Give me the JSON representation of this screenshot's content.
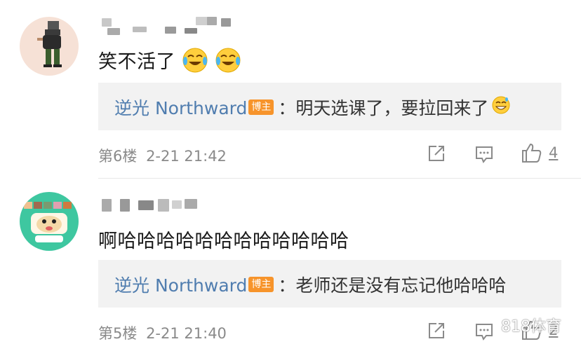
{
  "comments": [
    {
      "text": "笑不活了",
      "reply": {
        "author": "逆光 Northward",
        "badge": "博主",
        "text": "：明天选课了，要拉回来了"
      },
      "floor": "第6楼",
      "time": "2-21 21:42",
      "likes": "4"
    },
    {
      "text": "啊哈哈哈哈哈哈哈哈哈哈哈哈",
      "reply": {
        "author": "逆光 Northward",
        "badge": "博主",
        "text": "：老师还是没有忘记他哈哈哈"
      },
      "floor": "第5楼",
      "time": "2-21 21:40",
      "likes": "2"
    }
  ],
  "watermark": "818体育",
  "colors": {
    "author": "#507daf",
    "badge": "#f7942b",
    "meta": "#8a8a8a",
    "reply_bg": "#f2f2f2"
  },
  "icons": [
    "laugh-cry-emoji",
    "grin-sweat-emoji",
    "share-icon",
    "comment-icon",
    "thumbs-up-icon"
  ]
}
